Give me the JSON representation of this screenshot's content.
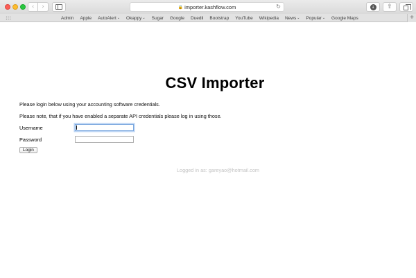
{
  "browser": {
    "url": "importer.kashflow.com",
    "back_icon": "‹",
    "forward_icon": "›",
    "reload_icon": "↻",
    "download_icon": "↓",
    "share_icon": "⇧",
    "new_tab_icon": "+"
  },
  "favorites": {
    "items": [
      {
        "label": "Admin",
        "has_menu": false
      },
      {
        "label": "Apple",
        "has_menu": false
      },
      {
        "label": "AutoAlert",
        "has_menu": true
      },
      {
        "label": "Okappy",
        "has_menu": true
      },
      {
        "label": "Sugar",
        "has_menu": false
      },
      {
        "label": "Google",
        "has_menu": false
      },
      {
        "label": "Duedil",
        "has_menu": false
      },
      {
        "label": "Bootstrap",
        "has_menu": false
      },
      {
        "label": "YouTube",
        "has_menu": false
      },
      {
        "label": "Wikipedia",
        "has_menu": false
      },
      {
        "label": "News",
        "has_menu": true
      },
      {
        "label": "Popular",
        "has_menu": true
      },
      {
        "label": "Google Maps",
        "has_menu": false
      }
    ]
  },
  "page": {
    "title": "CSV Importer",
    "intro": "Please login below using your accounting software credentials.",
    "note": "Please note, that if you have enabled a separate API credentials please log in using those.",
    "username_label": "Username",
    "username_value": "",
    "password_label": "Password",
    "password_value": "",
    "login_button": "Login",
    "logged_in_text": "Logged in as: gareyao@hotmail.com"
  },
  "colors": {
    "accent_focus": "#7aa7de",
    "muted_text": "#c4c4c4"
  }
}
